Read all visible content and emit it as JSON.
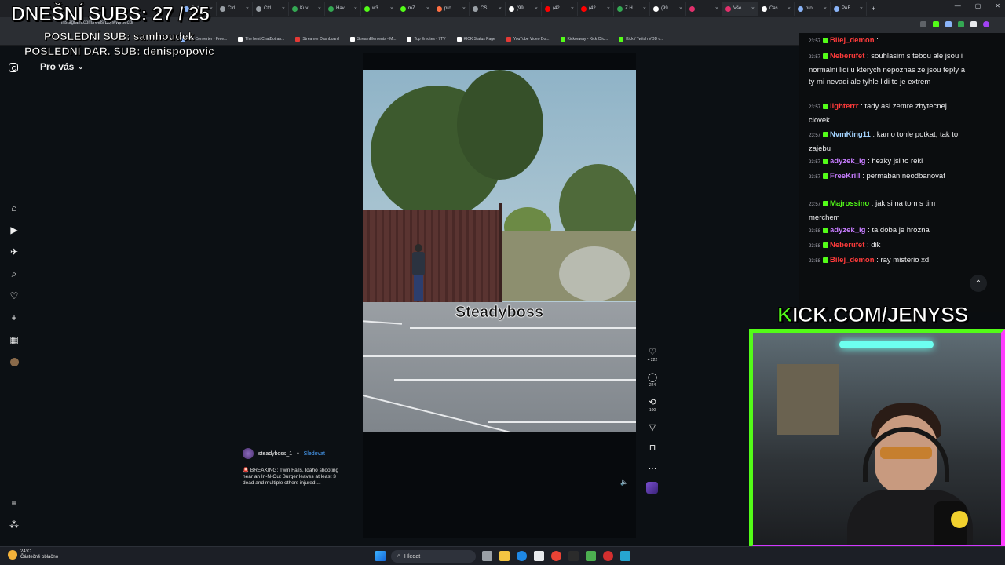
{
  "overlay": {
    "subs": "DNEŠNÍ SUBS: 27 / 25",
    "last_sub": "POSLEDNÍ SUB: samhoudek",
    "last_donation": "POSLEDNÍ DAR. SUB: denispopovic"
  },
  "browser": {
    "url": "instagram.com/reels/DJjMwjrtMcd/",
    "tabs": [
      {
        "label": "Bet",
        "color": "#8ab4f8"
      },
      {
        "label": "Ctrl",
        "color": "#9aa0a6"
      },
      {
        "label": "Ctrl",
        "color": "#9aa0a6"
      },
      {
        "label": "Kuv",
        "color": "#34a853"
      },
      {
        "label": "Hav",
        "color": "#34a853"
      },
      {
        "label": "w3",
        "color": "#53fc18"
      },
      {
        "label": "mZ",
        "color": "#53fc18"
      },
      {
        "label": "pro",
        "color": "#ff7043"
      },
      {
        "label": "CS",
        "color": "#9aa0a6"
      },
      {
        "label": "(99",
        "color": "#ffffff"
      },
      {
        "label": "(42",
        "color": "#ff0000"
      },
      {
        "label": "(42",
        "color": "#ff0000"
      },
      {
        "label": "Z H",
        "color": "#34a853"
      },
      {
        "label": "(99",
        "color": "#ffffff"
      },
      {
        "label": "",
        "color": "#e1306c"
      },
      {
        "label": "Vše",
        "color": "#e1306c"
      },
      {
        "label": "Cas",
        "color": "#ffffff"
      },
      {
        "label": "pro",
        "color": "#8ab4f8"
      },
      {
        "label": "PAF",
        "color": "#8ab4f8"
      }
    ],
    "bookmarks": [
      {
        "label": "File Converter - Free...",
        "color": "#8ab4f8"
      },
      {
        "label": "The best ChatBot an...",
        "color": "#ffffff"
      },
      {
        "label": "Streamer Dashboard",
        "color": "#e53935"
      },
      {
        "label": "StreamElements - M...",
        "color": "#ffffff"
      },
      {
        "label": "Top Emotes - 7TV",
        "color": "#ffffff"
      },
      {
        "label": "KICK Status Page",
        "color": "#ffffff"
      },
      {
        "label": "YouTube Video Do...",
        "color": "#e53935"
      },
      {
        "label": "Kickonway - Kick Clic...",
        "color": "#53fc18"
      },
      {
        "label": "Kick / Twitch VOD d...",
        "color": "#53fc18"
      }
    ]
  },
  "instagram": {
    "section": "Pro vás",
    "video_watermark": "Steadyboss",
    "likes": "4 222",
    "comments": "224",
    "reposts": "100",
    "author": "steadyboss_1",
    "follow_label": "Sledovat",
    "caption": "🚨 BREAKING: Twin Falls, Idaho shooting near an In-N-Out Burger leaves at least 3 dead and multiple others injured...."
  },
  "chat": {
    "messages": [
      {
        "time": "23:57",
        "user": "Bilej_demon",
        "color": "#ff3b3b",
        "badge": "#53fc18",
        "text": ""
      },
      {
        "time": "23:57",
        "user": "Neberufet",
        "color": "#ff3b3b",
        "badge": "#53fc18",
        "text": "souhlasim s tebou ale jsou i normalni lidi u kterych nepoznas ze jsou teply a ty mi nevadi ale tyhle lidi to je extrem"
      },
      {
        "time": "23:57",
        "user": "lighterrr",
        "color": "#ff3b3b",
        "badge": "#53fc18",
        "text": "tady asi zemre zbytecnej clovek"
      },
      {
        "time": "23:57",
        "user": "NvmKing11",
        "color": "#a4d4ff",
        "badge": "#53fc18",
        "text": "kamo tohle potkat, tak to zajebu"
      },
      {
        "time": "23:57",
        "user": "adyzek_ig",
        "color": "#c77dff",
        "badge": "#53fc18",
        "text": "hezky jsi to rekl"
      },
      {
        "time": "23:57",
        "user": "FreeKrill",
        "color": "#c77dff",
        "badge": "#53fc18",
        "text": "permaban neodbanovat"
      },
      {
        "time": "23:57",
        "user": "Majrossino",
        "color": "#53fc18",
        "badge": "#53fc18",
        "text": "jak si na tom s tim merchem"
      },
      {
        "time": "23:58",
        "user": "adyzek_ig",
        "color": "#c77dff",
        "badge": "#53fc18",
        "text": "ta doba je hrozna"
      },
      {
        "time": "23:58",
        "user": "Neberufet",
        "color": "#ff3b3b",
        "badge": "#53fc18",
        "text": "dik"
      },
      {
        "time": "23:58",
        "user": "Bilej_demon",
        "color": "#ff3b3b",
        "badge": "#53fc18",
        "text": "ray misterio xd"
      }
    ]
  },
  "kick": {
    "prefix": "K",
    "rest": "ICK.COM/JENYSS"
  },
  "taskbar": {
    "temp": "24°C",
    "weather": "Částečně oblačno",
    "search_label": "Hledat"
  }
}
